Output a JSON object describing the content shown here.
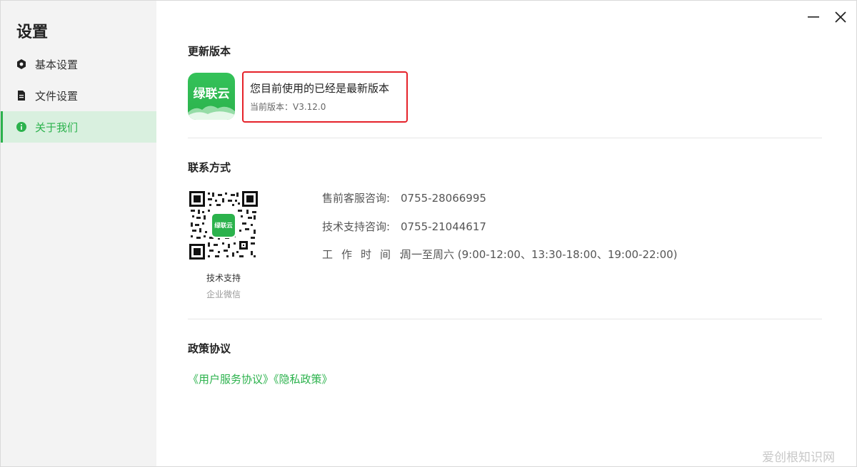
{
  "sidebar": {
    "title": "设置",
    "items": [
      {
        "label": "基本设置",
        "icon": "hexagon-icon"
      },
      {
        "label": "文件设置",
        "icon": "document-icon"
      },
      {
        "label": "关于我们",
        "icon": "info-icon"
      }
    ],
    "active_index": 2
  },
  "window_controls": {
    "minimize_icon": "minimize-icon",
    "close_icon": "close-icon"
  },
  "update": {
    "section_title": "更新版本",
    "logo_text": "绿联云",
    "message": "您目前使用的已经是最新版本",
    "version_label": "当前版本：V3.12.0"
  },
  "contact": {
    "section_title": "联系方式",
    "qr_logo_text": "绿联云",
    "qr_caption_title": "技术支持",
    "qr_caption_sub": "企业微信",
    "rows": [
      {
        "label": "售前客服咨询:",
        "value": "0755-28066995"
      },
      {
        "label": "技术支持咨询:",
        "value": "0755-21044617"
      },
      {
        "label": "工作时间:",
        "value": "周一至周六 (9:00-12:00、13:30-18:00、19:00-22:00)"
      }
    ]
  },
  "policy": {
    "section_title": "政策协议",
    "service_link": "《用户服务协议》",
    "privacy_link": "《隐私政策》"
  },
  "watermark": "爱创根知识网",
  "colors": {
    "accent": "#2bb24c",
    "highlight": "#e5222a",
    "sidebar_bg": "#f3f3f3",
    "active_bg": "#d9f0df"
  }
}
